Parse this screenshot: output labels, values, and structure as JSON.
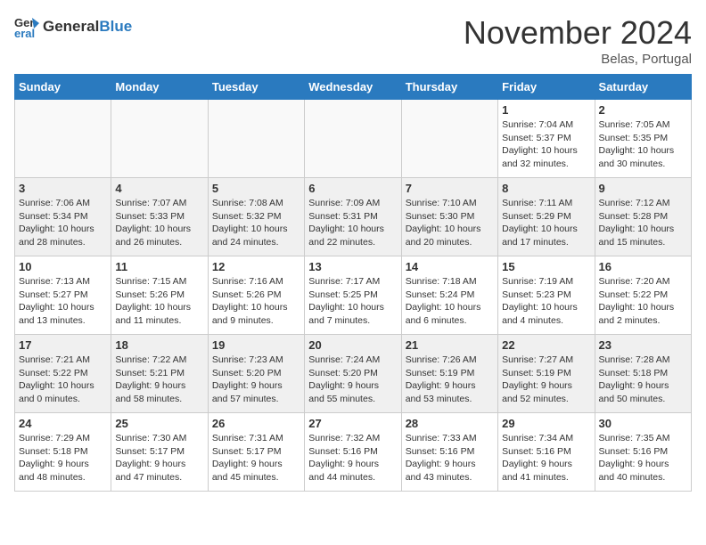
{
  "header": {
    "logo_line1": "General",
    "logo_line2": "Blue",
    "month": "November 2024",
    "location": "Belas, Portugal"
  },
  "weekdays": [
    "Sunday",
    "Monday",
    "Tuesday",
    "Wednesday",
    "Thursday",
    "Friday",
    "Saturday"
  ],
  "weeks": [
    [
      {
        "day": "",
        "info": ""
      },
      {
        "day": "",
        "info": ""
      },
      {
        "day": "",
        "info": ""
      },
      {
        "day": "",
        "info": ""
      },
      {
        "day": "",
        "info": ""
      },
      {
        "day": "1",
        "info": "Sunrise: 7:04 AM\nSunset: 5:37 PM\nDaylight: 10 hours\nand 32 minutes."
      },
      {
        "day": "2",
        "info": "Sunrise: 7:05 AM\nSunset: 5:35 PM\nDaylight: 10 hours\nand 30 minutes."
      }
    ],
    [
      {
        "day": "3",
        "info": "Sunrise: 7:06 AM\nSunset: 5:34 PM\nDaylight: 10 hours\nand 28 minutes."
      },
      {
        "day": "4",
        "info": "Sunrise: 7:07 AM\nSunset: 5:33 PM\nDaylight: 10 hours\nand 26 minutes."
      },
      {
        "day": "5",
        "info": "Sunrise: 7:08 AM\nSunset: 5:32 PM\nDaylight: 10 hours\nand 24 minutes."
      },
      {
        "day": "6",
        "info": "Sunrise: 7:09 AM\nSunset: 5:31 PM\nDaylight: 10 hours\nand 22 minutes."
      },
      {
        "day": "7",
        "info": "Sunrise: 7:10 AM\nSunset: 5:30 PM\nDaylight: 10 hours\nand 20 minutes."
      },
      {
        "day": "8",
        "info": "Sunrise: 7:11 AM\nSunset: 5:29 PM\nDaylight: 10 hours\nand 17 minutes."
      },
      {
        "day": "9",
        "info": "Sunrise: 7:12 AM\nSunset: 5:28 PM\nDaylight: 10 hours\nand 15 minutes."
      }
    ],
    [
      {
        "day": "10",
        "info": "Sunrise: 7:13 AM\nSunset: 5:27 PM\nDaylight: 10 hours\nand 13 minutes."
      },
      {
        "day": "11",
        "info": "Sunrise: 7:15 AM\nSunset: 5:26 PM\nDaylight: 10 hours\nand 11 minutes."
      },
      {
        "day": "12",
        "info": "Sunrise: 7:16 AM\nSunset: 5:26 PM\nDaylight: 10 hours\nand 9 minutes."
      },
      {
        "day": "13",
        "info": "Sunrise: 7:17 AM\nSunset: 5:25 PM\nDaylight: 10 hours\nand 7 minutes."
      },
      {
        "day": "14",
        "info": "Sunrise: 7:18 AM\nSunset: 5:24 PM\nDaylight: 10 hours\nand 6 minutes."
      },
      {
        "day": "15",
        "info": "Sunrise: 7:19 AM\nSunset: 5:23 PM\nDaylight: 10 hours\nand 4 minutes."
      },
      {
        "day": "16",
        "info": "Sunrise: 7:20 AM\nSunset: 5:22 PM\nDaylight: 10 hours\nand 2 minutes."
      }
    ],
    [
      {
        "day": "17",
        "info": "Sunrise: 7:21 AM\nSunset: 5:22 PM\nDaylight: 10 hours\nand 0 minutes."
      },
      {
        "day": "18",
        "info": "Sunrise: 7:22 AM\nSunset: 5:21 PM\nDaylight: 9 hours\nand 58 minutes."
      },
      {
        "day": "19",
        "info": "Sunrise: 7:23 AM\nSunset: 5:20 PM\nDaylight: 9 hours\nand 57 minutes."
      },
      {
        "day": "20",
        "info": "Sunrise: 7:24 AM\nSunset: 5:20 PM\nDaylight: 9 hours\nand 55 minutes."
      },
      {
        "day": "21",
        "info": "Sunrise: 7:26 AM\nSunset: 5:19 PM\nDaylight: 9 hours\nand 53 minutes."
      },
      {
        "day": "22",
        "info": "Sunrise: 7:27 AM\nSunset: 5:19 PM\nDaylight: 9 hours\nand 52 minutes."
      },
      {
        "day": "23",
        "info": "Sunrise: 7:28 AM\nSunset: 5:18 PM\nDaylight: 9 hours\nand 50 minutes."
      }
    ],
    [
      {
        "day": "24",
        "info": "Sunrise: 7:29 AM\nSunset: 5:18 PM\nDaylight: 9 hours\nand 48 minutes."
      },
      {
        "day": "25",
        "info": "Sunrise: 7:30 AM\nSunset: 5:17 PM\nDaylight: 9 hours\nand 47 minutes."
      },
      {
        "day": "26",
        "info": "Sunrise: 7:31 AM\nSunset: 5:17 PM\nDaylight: 9 hours\nand 45 minutes."
      },
      {
        "day": "27",
        "info": "Sunrise: 7:32 AM\nSunset: 5:16 PM\nDaylight: 9 hours\nand 44 minutes."
      },
      {
        "day": "28",
        "info": "Sunrise: 7:33 AM\nSunset: 5:16 PM\nDaylight: 9 hours\nand 43 minutes."
      },
      {
        "day": "29",
        "info": "Sunrise: 7:34 AM\nSunset: 5:16 PM\nDaylight: 9 hours\nand 41 minutes."
      },
      {
        "day": "30",
        "info": "Sunrise: 7:35 AM\nSunset: 5:16 PM\nDaylight: 9 hours\nand 40 minutes."
      }
    ]
  ]
}
